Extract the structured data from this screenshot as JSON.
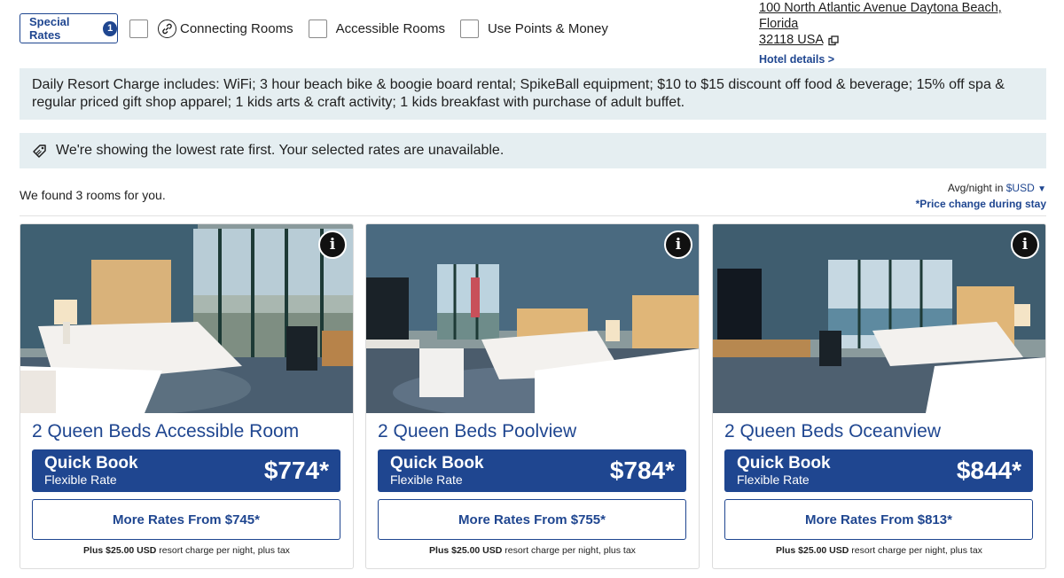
{
  "filters": {
    "special_rates_label": "Special Rates",
    "special_rates_count": "1",
    "connecting_rooms": "Connecting Rooms",
    "accessible_rooms": "Accessible Rooms",
    "points_money": "Use Points & Money"
  },
  "hotel": {
    "address_line1": "100 North Atlantic Avenue Daytona Beach, Florida",
    "address_line2": "32118 USA",
    "details_link": "Hotel details >"
  },
  "banners": {
    "resort_charge": "Daily Resort Charge includes: WiFi; 3 hour beach bike & boogie board rental; SpikeBall equipment; $10 to $15 discount off food & beverage; 15% off spa & regular priced gift shop apparel; 1 kids arts & craft activity; 1 kids breakfast with purchase of adult buffet.",
    "lowest_rate": "We're showing the lowest rate first. Your selected rates are unavailable."
  },
  "results": {
    "found_text": "We found 3 rooms for you.",
    "avg_label": "Avg/night in",
    "currency": "$USD",
    "price_change": "*Price change during stay"
  },
  "rooms": [
    {
      "title": "2 Queen Beds Accessible Room",
      "quick_book": "Quick Book",
      "rate_name": "Flexible Rate",
      "price": "$774*",
      "more_rates": "More Rates From $745*",
      "charge_amount": "Plus $25.00 USD",
      "charge_text": "resort charge per night, plus tax"
    },
    {
      "title": "2 Queen Beds Poolview",
      "quick_book": "Quick Book",
      "rate_name": "Flexible Rate",
      "price": "$784*",
      "more_rates": "More Rates From $755*",
      "charge_amount": "Plus $25.00 USD",
      "charge_text": "resort charge per night, plus tax"
    },
    {
      "title": "2 Queen Beds Oceanview",
      "quick_book": "Quick Book",
      "rate_name": "Flexible Rate",
      "price": "$844*",
      "more_rates": "More Rates From $813*",
      "charge_amount": "Plus $25.00 USD",
      "charge_text": "resort charge per night, plus tax"
    }
  ],
  "colors": {
    "brand_blue": "#1f4690",
    "banner_bg": "#e5eef1"
  }
}
